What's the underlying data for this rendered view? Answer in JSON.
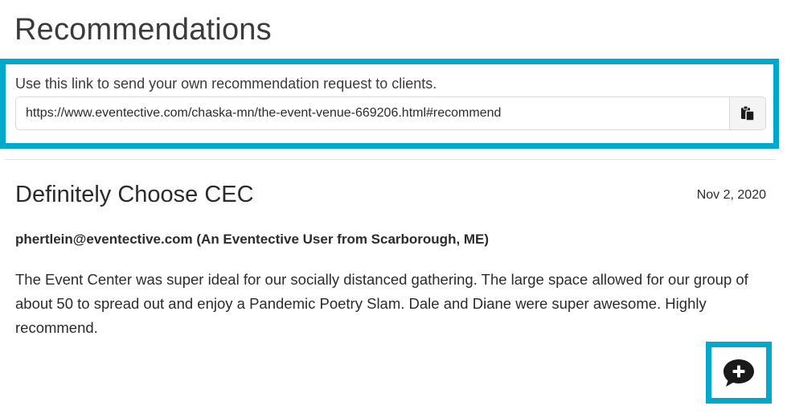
{
  "page": {
    "title": "Recommendations"
  },
  "share_link": {
    "hint": "Use this link to send your own recommendation request to clients.",
    "url": "https://www.eventective.com/chaska-mn/the-event-venue-669206.html#recommend",
    "copy_icon": "clipboard-icon"
  },
  "review": {
    "title": "Definitely Choose CEC",
    "date": "Nov 2, 2020",
    "author": "phertlein@eventective.com (An Eventective User from Scarborough, ME)",
    "body": "The Event Center was super ideal for our socially distanced gathering. The large space allowed for our group of about 50 to spread out and enjoy a Pandemic Poetry Slam. Dale and Diane were super awesome. Highly recommend."
  },
  "comment_action": {
    "icon": "comment-plus-icon"
  },
  "colors": {
    "highlight": "#00a8c9",
    "text": "#2b2b2b",
    "icon": "#1a1a1a"
  }
}
